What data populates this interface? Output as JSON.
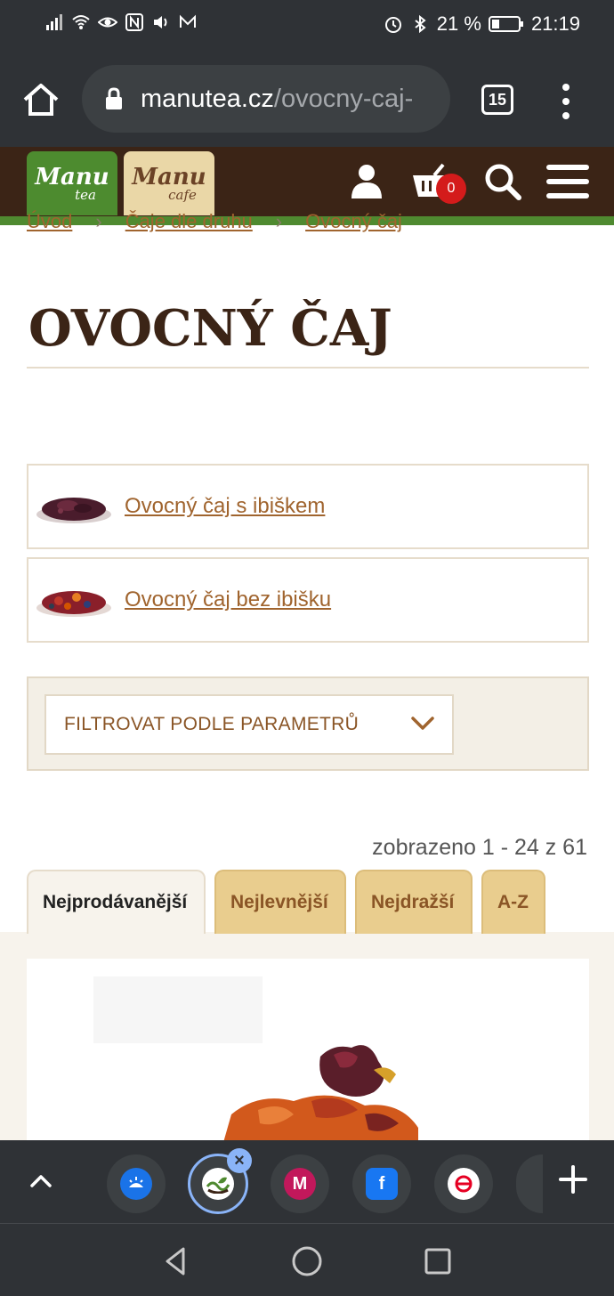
{
  "status_bar": {
    "battery_percent": "21 %",
    "time": "21:19"
  },
  "browser": {
    "url_host": "manutea.cz",
    "url_path": "/ovocny-caj-",
    "tab_count": "15"
  },
  "site": {
    "logo_tea": {
      "main": "Manu",
      "sub": "tea"
    },
    "logo_cafe": {
      "main": "Manu",
      "sub": "cafe"
    },
    "cart_count": "0"
  },
  "breadcrumb": {
    "items": [
      "Úvod",
      "Čaje dle druhu",
      "Ovocný čaj"
    ]
  },
  "page": {
    "title": "OVOCNÝ ČAJ"
  },
  "categories": [
    {
      "label": "Ovocný čaj s ibiškem"
    },
    {
      "label": "Ovocný čaj bez ibišku"
    }
  ],
  "filter": {
    "label": "FILTROVAT PODLE PARAMETRŮ"
  },
  "results": {
    "count_text": "zobrazeno 1 - 24 z 61"
  },
  "sort_tabs": [
    {
      "label": "Nejprodávanější",
      "active": true
    },
    {
      "label": "Nejlevnější",
      "active": false
    },
    {
      "label": "Nejdražší",
      "active": false
    },
    {
      "label": "A-Z",
      "active": false
    }
  ],
  "tab_strip": {
    "tabs": [
      {
        "icon": "sun-icon",
        "color": "#1a73e8"
      },
      {
        "icon": "manutea-icon",
        "color": "#ffffff"
      },
      {
        "icon": "m-icon",
        "color": "#c2185b"
      },
      {
        "icon": "facebook-icon",
        "color": "#1877f2"
      },
      {
        "icon": "pinterest-icon",
        "color": "#ffffff"
      }
    ]
  },
  "colors": {
    "brand_brown": "#3b2416",
    "brand_green": "#4f8a30",
    "link": "#a0642e",
    "tab_gold": "#e9cd8e",
    "badge_red": "#d41b1b"
  }
}
